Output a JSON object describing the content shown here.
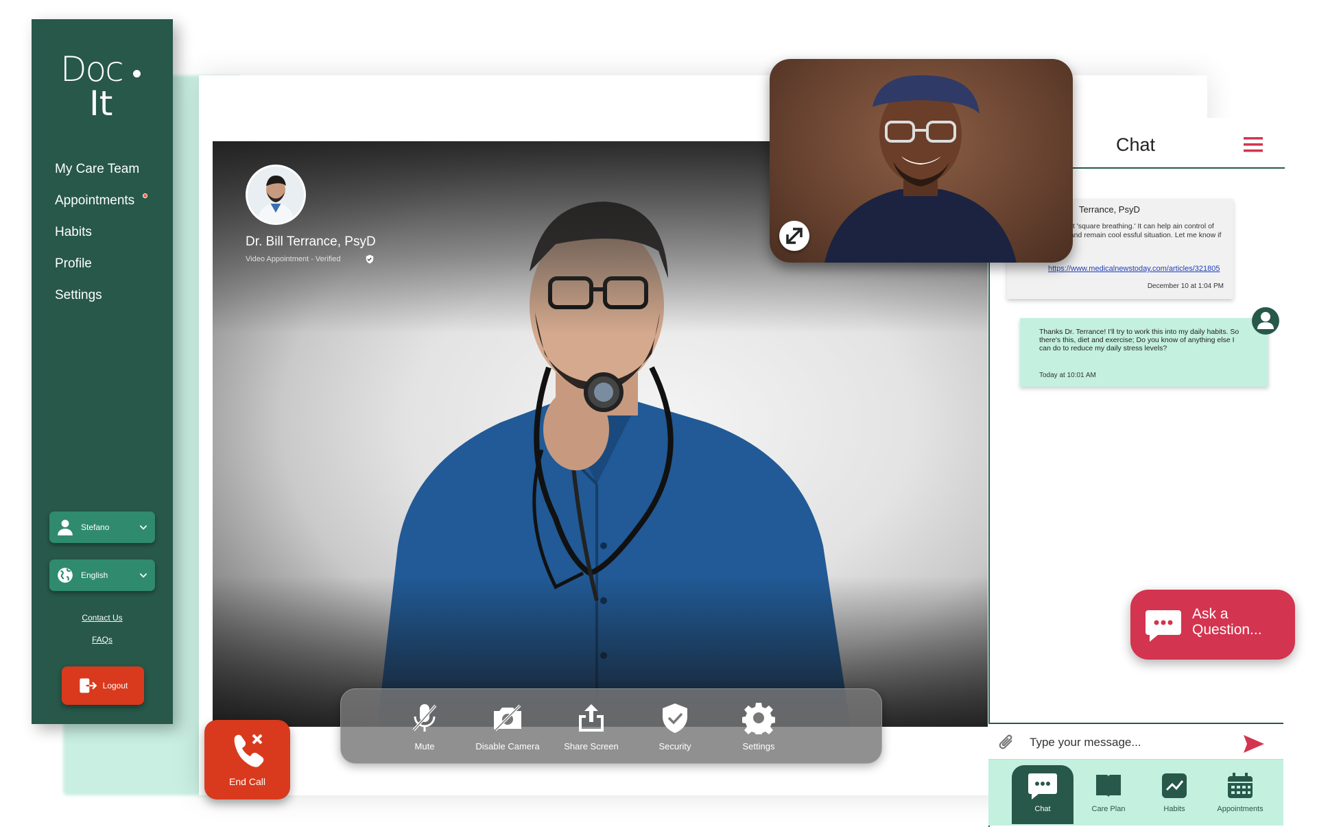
{
  "brand": {
    "line1": "Doc",
    "line2": "It"
  },
  "sidebar": {
    "nav": [
      {
        "label": "My Care Team"
      },
      {
        "label": "Appointments",
        "has_notification": true
      },
      {
        "label": "Habits"
      },
      {
        "label": "Profile"
      },
      {
        "label": "Settings"
      }
    ],
    "user_select": {
      "value": "Stefano",
      "icon": "user-icon"
    },
    "language_select": {
      "value": "English",
      "icon": "globe-icon"
    },
    "contact_link": "Contact Us",
    "faq_link": "FAQs",
    "logout_label": "Logout"
  },
  "video": {
    "doctor_name": "Dr. Bill Terrance, PsyD",
    "subtitle": "Video Appointment - Verified"
  },
  "controls": {
    "mute": "Mute",
    "disable_camera": "Disable Camera",
    "share_screen": "Share Screen",
    "security": "Security",
    "settings": "Settings",
    "end_call": "End Call"
  },
  "chat": {
    "title": "Chat",
    "incoming": {
      "sender": "Terrance, PsyD",
      "body": "a resource about 'square breathing.' It can help ain control of your amygdala and remain cool essful situation. Let me know if you need more",
      "link": "https://www.medicalnewstoday.com/articles/321805",
      "time": "December 10 at 1:04 PM"
    },
    "outgoing": {
      "body": "Thanks Dr. Terrance! I'll try to work this into my daily habits. So there's this, diet and exercise; Do you know of anything else I can do to reduce my daily stress levels?",
      "time": "Today at 10:01 AM"
    },
    "ask_button": "Ask a Question...",
    "input_placeholder": "Type your message..."
  },
  "bottom_nav": [
    {
      "label": "Chat",
      "icon": "chat-icon",
      "active": true
    },
    {
      "label": "Care Plan",
      "icon": "book-icon",
      "active": false
    },
    {
      "label": "Habits",
      "icon": "chart-icon",
      "active": false
    },
    {
      "label": "Appointments",
      "icon": "calendar-icon",
      "active": false
    }
  ],
  "colors": {
    "sidebar": "#27584a",
    "accent_mint": "#c4f0df",
    "danger": "#d93a1d",
    "ask": "#d3344f",
    "menu": "#d3344f"
  }
}
